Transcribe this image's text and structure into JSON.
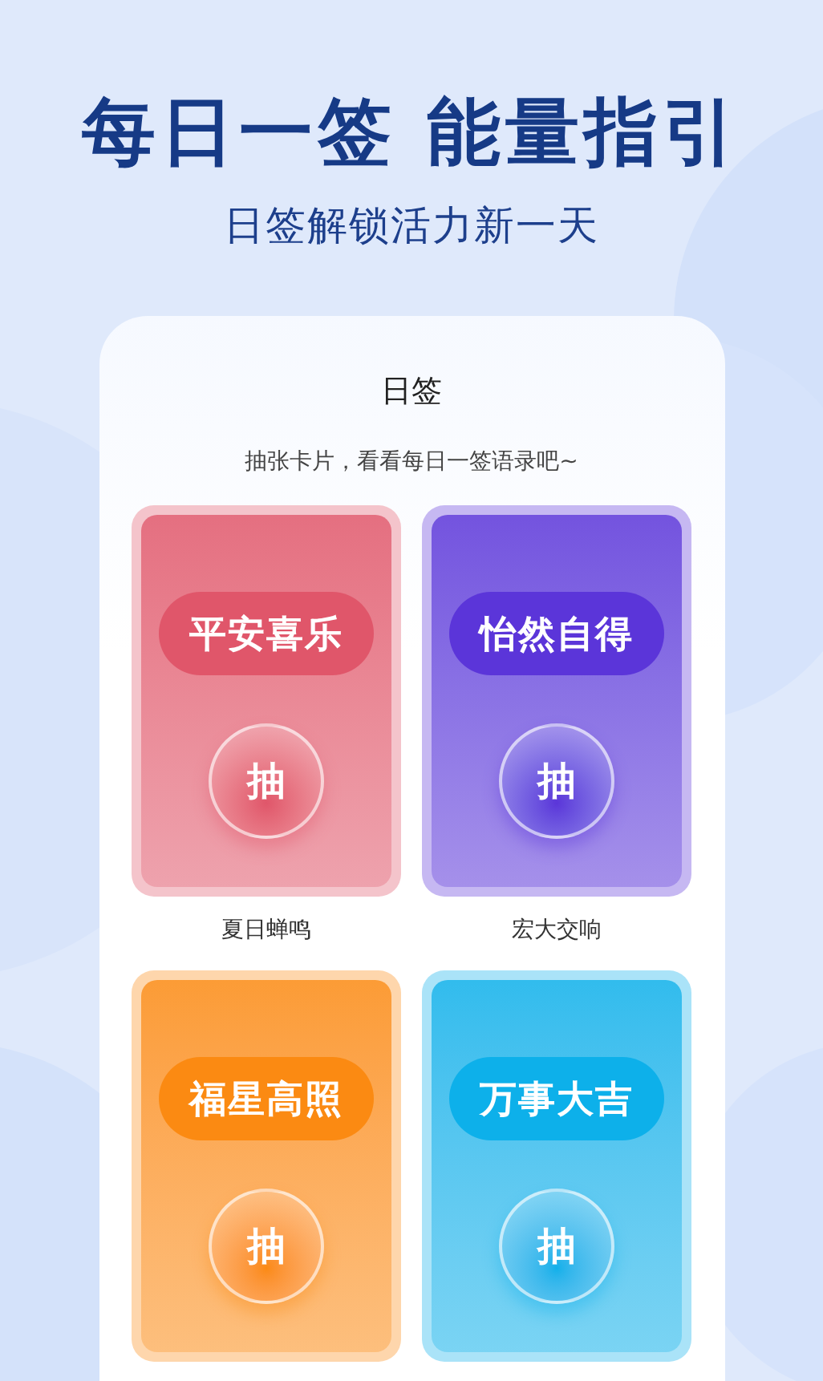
{
  "headline": "每日一签 能量指引",
  "subheadline": "日签解锁活力新一天",
  "panel": {
    "title": "日签",
    "hint": "抽张卡片，看看每日一签语录吧~",
    "cards": [
      {
        "title": "平安喜乐",
        "button": "抽",
        "caption": "夏日蝉鸣",
        "color": "#e0566a"
      },
      {
        "title": "怡然自得",
        "button": "抽",
        "caption": "宏大交响",
        "color": "#5b35d9"
      },
      {
        "title": "福星高照",
        "button": "抽",
        "color": "#fb8a12"
      },
      {
        "title": "万事大吉",
        "button": "抽",
        "color": "#0db0ea"
      }
    ]
  }
}
